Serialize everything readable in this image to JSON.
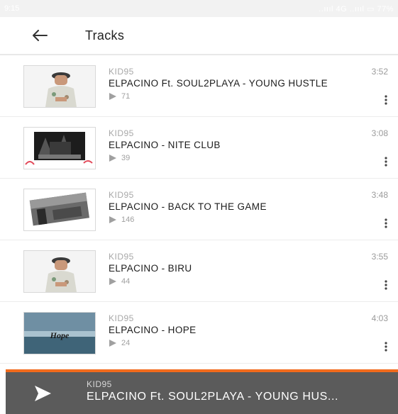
{
  "status": {
    "time": "9:15",
    "right": "..ıııl 4G ..ıııl ▭ 77%"
  },
  "appbar": {
    "title": "Tracks"
  },
  "colors": {
    "accent": "#f26b1d",
    "player_bg": "#5b5b5b"
  },
  "tracks": [
    {
      "artist": "KID95",
      "title": "ELPACINO Ft. SOUL2PLAYA - YOUNG HUSTLE",
      "duration": "3:52",
      "plays": "71"
    },
    {
      "artist": "KID95",
      "title": "ELPACINO - NITE CLUB",
      "duration": "3:08",
      "plays": "39"
    },
    {
      "artist": "KID95",
      "title": "ELPACINO - BACK TO THE GAME",
      "duration": "3:48",
      "plays": "146"
    },
    {
      "artist": "KID95",
      "title": "ELPACINO - BIRU",
      "duration": "3:55",
      "plays": "44"
    },
    {
      "artist": "KID95",
      "title": "ELPACINO - HOPE",
      "duration": "4:03",
      "plays": "24"
    }
  ],
  "player": {
    "artist": "KID95",
    "title": "ELPACINO Ft. SOUL2PLAYA - YOUNG HUS..."
  }
}
